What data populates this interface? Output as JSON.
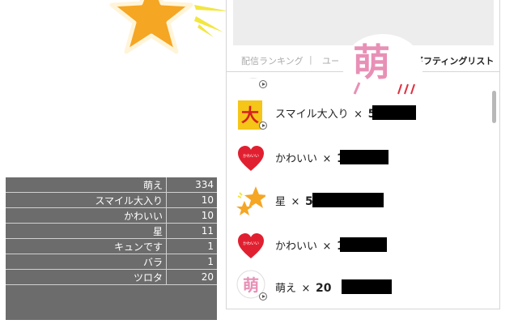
{
  "stats": {
    "rows": [
      {
        "name": "萌え",
        "count": "334"
      },
      {
        "name": "スマイル大入り",
        "count": "10"
      },
      {
        "name": "かわいい",
        "count": "10"
      },
      {
        "name": "星",
        "count": "11"
      },
      {
        "name": "キュンです",
        "count": "1"
      },
      {
        "name": "バラ",
        "count": "1"
      },
      {
        "name": "ツロタ",
        "count": "20"
      }
    ]
  },
  "tabs": {
    "ranking": "配信ランキング",
    "separator": "|",
    "user": "ユー",
    "gift_list": "ギフティングリスト"
  },
  "badge": {
    "char": "萌"
  },
  "gifts": [
    {
      "icon": "smile-big-icon",
      "name": "スマイル大入り",
      "mult": "×",
      "count": "5"
    },
    {
      "icon": "heart-kawaii-icon",
      "name": "かわいい",
      "mult": "×",
      "count": "1"
    },
    {
      "icon": "star-icon",
      "name": "星",
      "mult": "×",
      "count": "5"
    },
    {
      "icon": "heart-kawaii-icon",
      "name": "かわいい",
      "mult": "×",
      "count": "1"
    },
    {
      "icon": "moe-icon",
      "name": "萌え",
      "mult": "×",
      "count": "20"
    }
  ],
  "colors": {
    "panel_bg": "#6c6c6c",
    "accent_pink": "#e890b6",
    "star_orange": "#f5a623",
    "heart_red": "#e02030"
  }
}
